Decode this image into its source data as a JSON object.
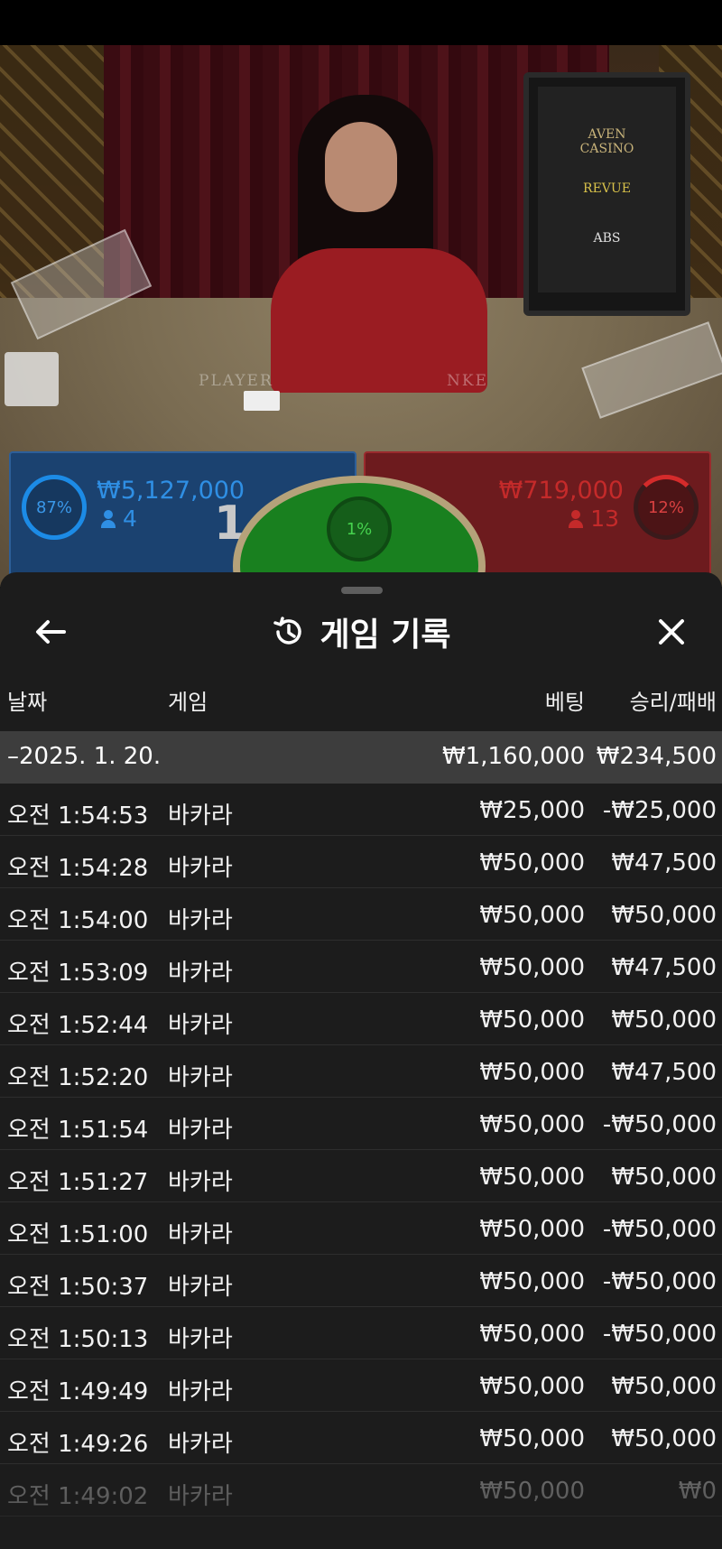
{
  "colors": {
    "player_blue": "#2f8fe4",
    "banker_red": "#c42a2a",
    "tie_green": "#46d24e",
    "sheet_bg": "#1c1c1c",
    "summary_bg": "#3d3d3d"
  },
  "live_table": {
    "monitor_logos": [
      "AVEN\nCASINO",
      "REVUE",
      "ABS"
    ],
    "table_print": [
      "PLAYER",
      "NKE"
    ],
    "player": {
      "percent": "87%",
      "amount": "₩5,127,000",
      "players": "4",
      "score": "1"
    },
    "tie": {
      "percent": "1%"
    },
    "banker": {
      "percent": "12%",
      "amount": "₩719,000",
      "players": "13"
    }
  },
  "sheet": {
    "title": "게임 기록",
    "icons": {
      "back": "arrow-left-icon",
      "title": "history-icon",
      "close": "close-icon"
    },
    "columns": {
      "date": "날짜",
      "game": "게임",
      "bet": "베팅",
      "result": "승리/패배"
    },
    "summary": {
      "date": "–2025. 1. 20.",
      "bet": "₩1,160,000",
      "result": "₩234,500"
    },
    "rows": [
      {
        "time": "오전 1:54:53",
        "game": "바카라",
        "bet": "₩25,000",
        "result": "-₩25,000"
      },
      {
        "time": "오전 1:54:28",
        "game": "바카라",
        "bet": "₩50,000",
        "result": "₩47,500"
      },
      {
        "time": "오전 1:54:00",
        "game": "바카라",
        "bet": "₩50,000",
        "result": "₩50,000"
      },
      {
        "time": "오전 1:53:09",
        "game": "바카라",
        "bet": "₩50,000",
        "result": "₩47,500"
      },
      {
        "time": "오전 1:52:44",
        "game": "바카라",
        "bet": "₩50,000",
        "result": "₩50,000"
      },
      {
        "time": "오전 1:52:20",
        "game": "바카라",
        "bet": "₩50,000",
        "result": "₩47,500"
      },
      {
        "time": "오전 1:51:54",
        "game": "바카라",
        "bet": "₩50,000",
        "result": "-₩50,000"
      },
      {
        "time": "오전 1:51:27",
        "game": "바카라",
        "bet": "₩50,000",
        "result": "₩50,000"
      },
      {
        "time": "오전 1:51:00",
        "game": "바카라",
        "bet": "₩50,000",
        "result": "-₩50,000"
      },
      {
        "time": "오전 1:50:37",
        "game": "바카라",
        "bet": "₩50,000",
        "result": "-₩50,000"
      },
      {
        "time": "오전 1:50:13",
        "game": "바카라",
        "bet": "₩50,000",
        "result": "-₩50,000"
      },
      {
        "time": "오전 1:49:49",
        "game": "바카라",
        "bet": "₩50,000",
        "result": "₩50,000"
      },
      {
        "time": "오전 1:49:26",
        "game": "바카라",
        "bet": "₩50,000",
        "result": "₩50,000"
      },
      {
        "time": "오전 1:49:02",
        "game": "바카라",
        "bet": "₩50,000",
        "result": "₩0"
      }
    ]
  }
}
